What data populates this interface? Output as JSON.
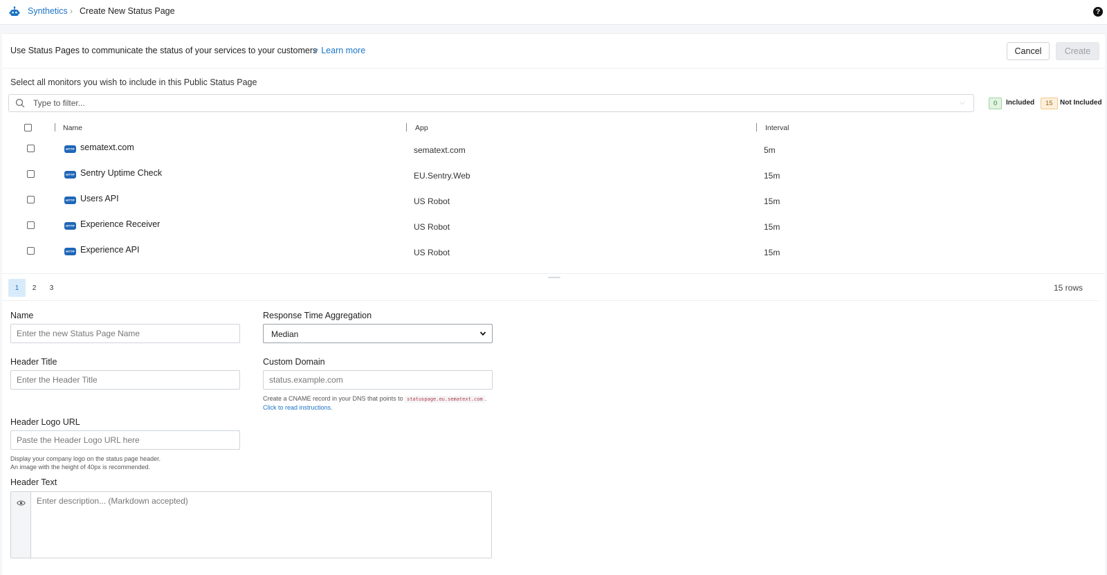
{
  "breadcrumb": {
    "app": "Synthetics",
    "separator": "›",
    "current": "Create New Status Page"
  },
  "help_icon": "?",
  "intro": {
    "text": "Use Status Pages to communicate the status of your services to your customers",
    "learn_more": "Learn more"
  },
  "buttons": {
    "cancel": "Cancel",
    "create": "Create"
  },
  "monitors": {
    "hint": "Select all monitors you wish to include in this Public Status Page",
    "filter_placeholder": "Type to filter...",
    "included_count": "0",
    "included_label": "Included",
    "not_included_count": "15",
    "not_included_label": "Not Included",
    "columns": {
      "name": "Name",
      "app": "App",
      "interval": "Interval"
    },
    "rows": [
      {
        "name": "sematext.com",
        "app": "sematext.com",
        "interval": "5m"
      },
      {
        "name": "Sentry Uptime Check",
        "app": "EU.Sentry.Web",
        "interval": "15m"
      },
      {
        "name": "Users API",
        "app": "US Robot",
        "interval": "15m"
      },
      {
        "name": "Experience Receiver",
        "app": "US Robot",
        "interval": "15m"
      },
      {
        "name": "Experience API",
        "app": "US Robot",
        "interval": "15m"
      }
    ],
    "http_badge": "HTTP",
    "pages": [
      "1",
      "2",
      "3"
    ],
    "rows_count": "15 rows"
  },
  "form": {
    "name": {
      "label": "Name",
      "placeholder": "Enter the new Status Page Name"
    },
    "aggregation": {
      "label": "Response Time Aggregation",
      "value": "Median"
    },
    "header_title": {
      "label": "Header Title",
      "placeholder": "Enter the Header Title"
    },
    "custom_domain": {
      "label": "Custom Domain",
      "placeholder": "status.example.com",
      "hint_prefix": "Create a CNAME record in your DNS that points to",
      "hint_code": "statuspage.eu.sematext.com",
      "hint_suffix": ".",
      "hint_link": "Click to read instructions."
    },
    "header_logo": {
      "label": "Header Logo URL",
      "placeholder": "Paste the Header Logo URL here",
      "hint_line1": "Display your company logo on the status page header.",
      "hint_line2": "An image with the height of 40px is recommended."
    },
    "header_text": {
      "label": "Header Text",
      "placeholder": "Enter description... (Markdown accepted)"
    }
  },
  "colors": {
    "accent": "#1b74c6",
    "http_badge": "#1f66b8",
    "included": "#2f7a2f",
    "not_included": "#9a6412"
  }
}
